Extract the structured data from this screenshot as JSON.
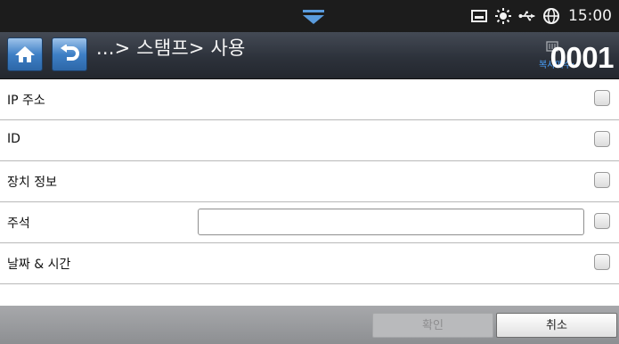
{
  "status_bar": {
    "time": "15:00",
    "icons": [
      "pull-down-handle-icon",
      "tray-icon",
      "toner-sun-icon",
      "usb-icon",
      "globe-icon"
    ]
  },
  "header": {
    "breadcrumb": "...> 스탬프> 사용",
    "copies_label": "복사매수:",
    "copies_count": "0001"
  },
  "list": {
    "items": [
      {
        "label": "IP 주소",
        "checked": false
      },
      {
        "label": "ID",
        "checked": false
      },
      {
        "label": "장치 정보",
        "checked": false
      },
      {
        "label": "주석",
        "checked": false,
        "text_value": ""
      },
      {
        "label": "날짜 & 시간",
        "checked": false
      }
    ]
  },
  "footer": {
    "ok_label": "확인",
    "cancel_label": "취소",
    "ok_enabled": false
  },
  "colors": {
    "status_bg": "#1c1c1c",
    "accent_blue": "#3f80c6",
    "copies_label": "#4aa3ff",
    "footer_bg": "#9b9c9f"
  }
}
